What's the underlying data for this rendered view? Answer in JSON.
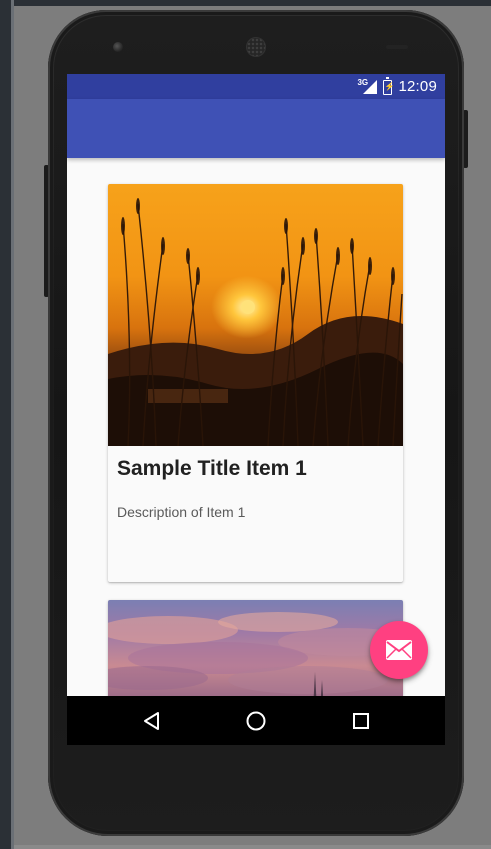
{
  "device": {
    "frame_color": "#1c1c1c",
    "screen_background": "#fafafa"
  },
  "status_bar": {
    "network_type": "3G",
    "time": "12:09",
    "color": "#303f9f",
    "icons": [
      "signal-icon",
      "battery-charging-icon"
    ]
  },
  "app_bar": {
    "color": "#3f51b5"
  },
  "cards": [
    {
      "title": "Sample Title Item 1",
      "description": "Description of Item 1",
      "image": "sunset-grass-image"
    },
    {
      "image": "purple-clouds-image"
    }
  ],
  "fab": {
    "icon": "envelope-icon",
    "color": "#ff4081"
  },
  "navigation_bar": {
    "buttons": [
      "back-icon",
      "home-icon",
      "recent-apps-icon"
    ]
  }
}
